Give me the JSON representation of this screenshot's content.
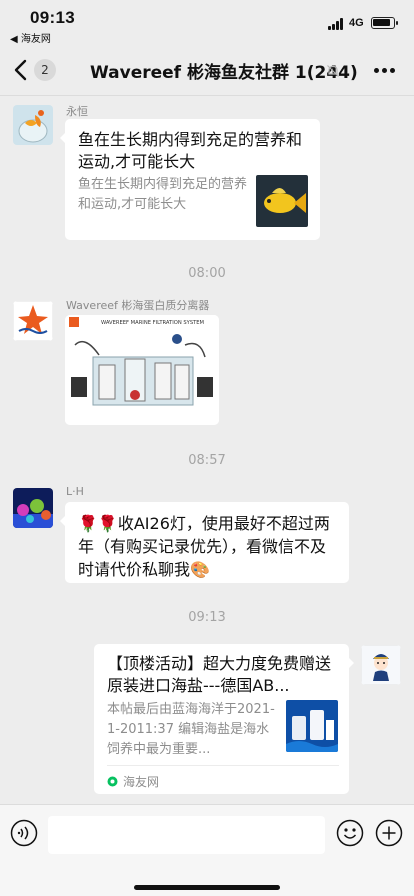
{
  "status_bar": {
    "time": "09:13",
    "back_app": "◀ 海友网",
    "network": "4G"
  },
  "header": {
    "unread_count": "2",
    "title": "Wavereef 彬海鱼友社群 1(244)"
  },
  "messages": [
    {
      "sender": "永恒",
      "card_title": "鱼在生长期内得到充足的营养和运动,才可能长大",
      "card_desc": "鱼在生长期内得到充足的营养和运动,才可能长大"
    },
    {
      "timestamp": "08:00"
    },
    {
      "sender": "Wavereef 彬海蛋白质分离器",
      "image_caption": "WAVEREEF MARINE FILTRATION SYSTEM"
    },
    {
      "timestamp": "08:57"
    },
    {
      "sender": "L·H",
      "text": "🌹🌹收AI26灯，使用最好不超过两年（有购买记录优先），看微信不及时请代价私聊我🎨"
    },
    {
      "timestamp": "09:13"
    },
    {
      "card_title": "【顶楼活动】超大力度免费赠送原装进口海盐---德国AB...",
      "card_desc": "本帖最后由蓝海海洋于2021-1-2011:37 编辑海盐是海水饲养中最为重要...",
      "card_source": "海友网"
    }
  ],
  "colors": {
    "background": "#ededed",
    "bubble": "#ffffff",
    "secondary_text": "#8d8d8d",
    "source_green": "#07c160"
  }
}
